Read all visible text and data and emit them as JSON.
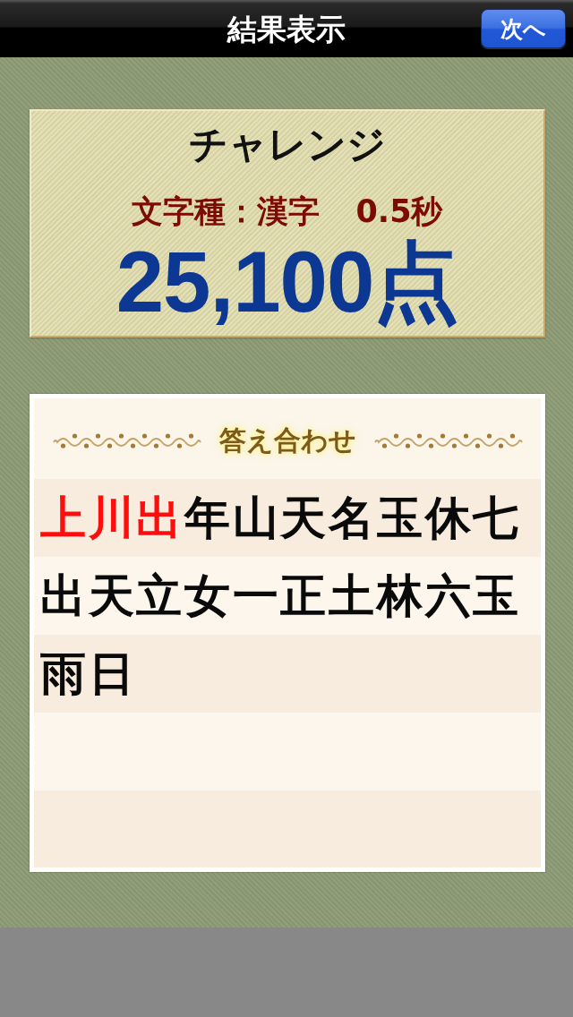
{
  "navigation_bar": {
    "title": "結果表示",
    "next_button": "次へ"
  },
  "score_card": {
    "mode": "チャレンジ",
    "character_type": "文字種：漢字",
    "time": "0.5秒",
    "score": "25,100点"
  },
  "answer_panel": {
    "title": "答え合わせ",
    "rows": [
      [
        {
          "char": "上",
          "highlighted": true
        },
        {
          "char": "川",
          "highlighted": true
        },
        {
          "char": "出",
          "highlighted": true
        },
        {
          "char": "年",
          "highlighted": false
        },
        {
          "char": "山",
          "highlighted": false
        },
        {
          "char": "天",
          "highlighted": false
        },
        {
          "char": "名",
          "highlighted": false
        },
        {
          "char": "玉",
          "highlighted": false
        },
        {
          "char": "休",
          "highlighted": false
        },
        {
          "char": "七",
          "highlighted": false
        }
      ],
      [
        {
          "char": "出",
          "highlighted": false
        },
        {
          "char": "天",
          "highlighted": false
        },
        {
          "char": "立",
          "highlighted": false
        },
        {
          "char": "女",
          "highlighted": false
        },
        {
          "char": "一",
          "highlighted": false
        },
        {
          "char": "正",
          "highlighted": false
        },
        {
          "char": "土",
          "highlighted": false
        },
        {
          "char": "林",
          "highlighted": false
        },
        {
          "char": "六",
          "highlighted": false
        },
        {
          "char": "玉",
          "highlighted": false
        }
      ],
      [
        {
          "char": "雨",
          "highlighted": false
        },
        {
          "char": "日",
          "highlighted": false
        }
      ]
    ]
  }
}
